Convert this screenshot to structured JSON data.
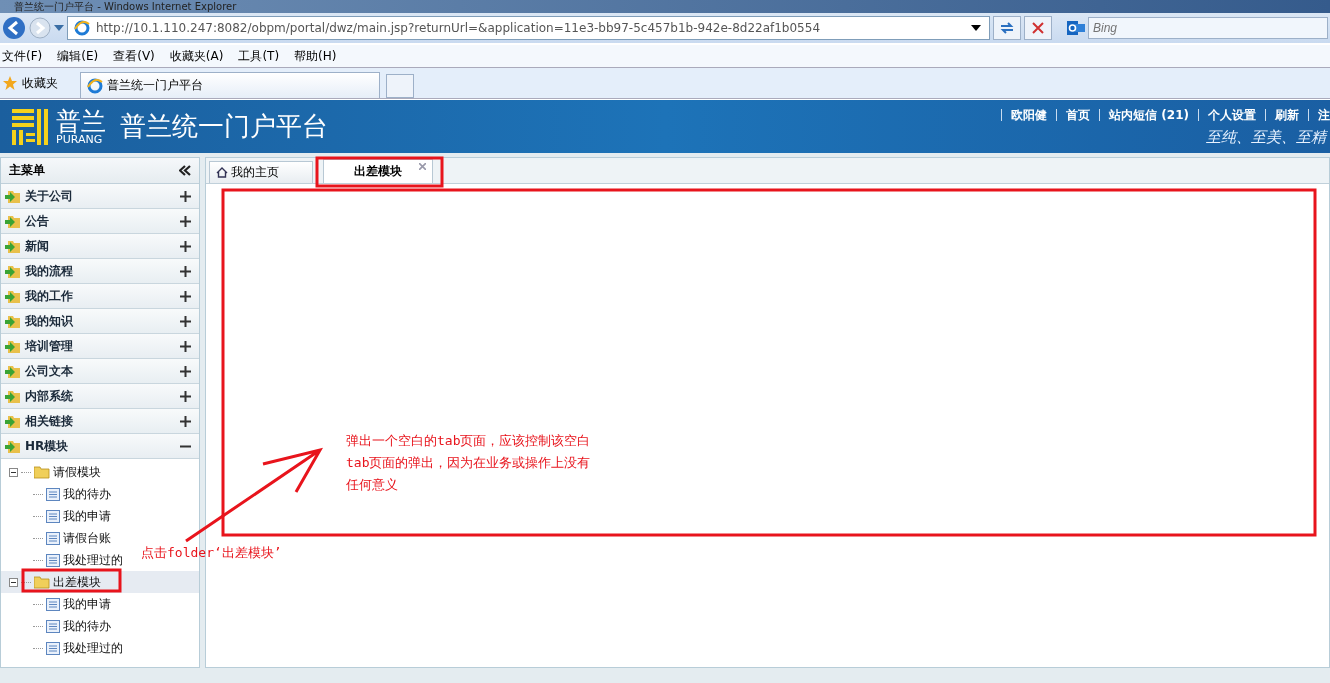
{
  "window": {
    "title": "普兰统一门户平台 - Windows Internet Explorer"
  },
  "browser": {
    "address": "http://10.1.110.247:8082/obpm/portal/dwz/main.jsp?returnUrl=&application=11e3-bb97-5c457b1b-942e-8d22af1b0554",
    "search_placeholder": "Bing",
    "menu": [
      "文件(F)",
      "编辑(E)",
      "查看(V)",
      "收藏夹(A)",
      "工具(T)",
      "帮助(H)"
    ],
    "favorites": "收藏夹",
    "tab": "普兰统一门户平台"
  },
  "header": {
    "logo": "普兰",
    "logo_sub": "PURANG",
    "title": "普兰统一门户平台",
    "links": [
      "欧阳健",
      "首页",
      "站内短信 (21)",
      "个人设置",
      "刷新",
      "注"
    ],
    "slogan": "至纯、至美、至精"
  },
  "sidebar": {
    "title": "主菜单",
    "items": [
      {
        "label": "关于公司",
        "expanded": false
      },
      {
        "label": "公告",
        "expanded": false
      },
      {
        "label": "新闻",
        "expanded": false
      },
      {
        "label": "我的流程",
        "expanded": false
      },
      {
        "label": "我的工作",
        "expanded": false
      },
      {
        "label": "我的知识",
        "expanded": false
      },
      {
        "label": "培训管理",
        "expanded": false
      },
      {
        "label": "公司文本",
        "expanded": false
      },
      {
        "label": "内部系统",
        "expanded": false
      },
      {
        "label": "相关链接",
        "expanded": false
      },
      {
        "label": "HR模块",
        "expanded": true,
        "children": [
          {
            "label": "请假模块",
            "selected": false,
            "children": [
              {
                "label": "我的待办"
              },
              {
                "label": "我的申请"
              },
              {
                "label": "请假台账"
              },
              {
                "label": "我处理过的"
              }
            ]
          },
          {
            "label": "出差模块",
            "selected": true,
            "children": [
              {
                "label": "我的申请"
              },
              {
                "label": "我的待办"
              },
              {
                "label": "我处理过的"
              }
            ]
          }
        ]
      }
    ]
  },
  "tabs": [
    {
      "label": "我的主页",
      "selected": false
    },
    {
      "label": "出差模块",
      "selected": true
    }
  ],
  "annotations": [
    {
      "lines": [
        "弹出一个空白的tab页面，应该控制该空白",
        "tab页面的弹出，因为在业务或操作上没有",
        "任何意义"
      ]
    },
    {
      "lines": [
        "点击folder‘出差模块’"
      ]
    }
  ]
}
